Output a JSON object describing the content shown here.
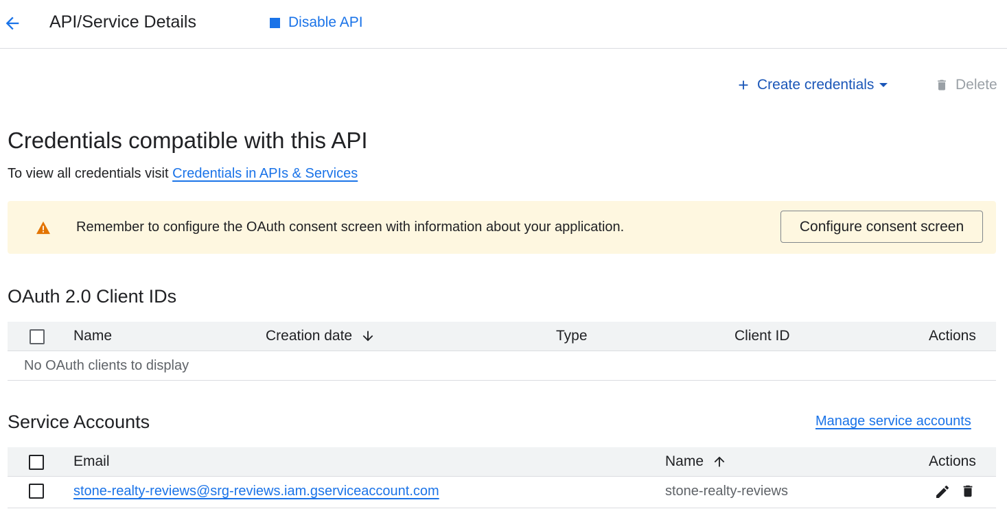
{
  "header": {
    "back_icon": "arrow-back-icon",
    "title": "API/Service Details",
    "disable_api_label": "Disable API",
    "disable_api_icon": "stop-icon"
  },
  "toolbar": {
    "create_credentials_label": "Create credentials",
    "create_credentials_icon": "plus-icon",
    "delete_label": "Delete",
    "delete_icon": "trash-icon"
  },
  "credentials": {
    "title": "Credentials compatible with this API",
    "subtitle_prefix": "To view all credentials visit",
    "subtitle_link": "Credentials in APIs & Services"
  },
  "warning": {
    "icon": "warning-icon",
    "text": "Remember to configure the OAuth consent screen with information about your application.",
    "button_label": "Configure consent screen"
  },
  "oauth": {
    "title": "OAuth 2.0 Client IDs",
    "columns": [
      "Name",
      "Creation date",
      "Type",
      "Client ID",
      "Actions"
    ],
    "sort_column": "Creation date",
    "sort_direction": "descending",
    "empty_message": "No OAuth clients to display"
  },
  "service_accounts": {
    "title": "Service Accounts",
    "manage_link": "Manage service accounts",
    "columns": [
      "Email",
      "Name",
      "Actions"
    ],
    "sort_column": "Name",
    "sort_direction": "ascending",
    "rows": [
      {
        "email": "stone-realty-reviews@srg-reviews.iam.gserviceaccount.com",
        "name": "stone-realty-reviews",
        "actions": [
          "edit-icon",
          "trash-icon"
        ]
      }
    ]
  },
  "colors": {
    "accent": "#1a73e8",
    "warning_bg": "#fef7e0",
    "warning_icon": "#e37400",
    "header_bg": "#f1f3f4"
  }
}
